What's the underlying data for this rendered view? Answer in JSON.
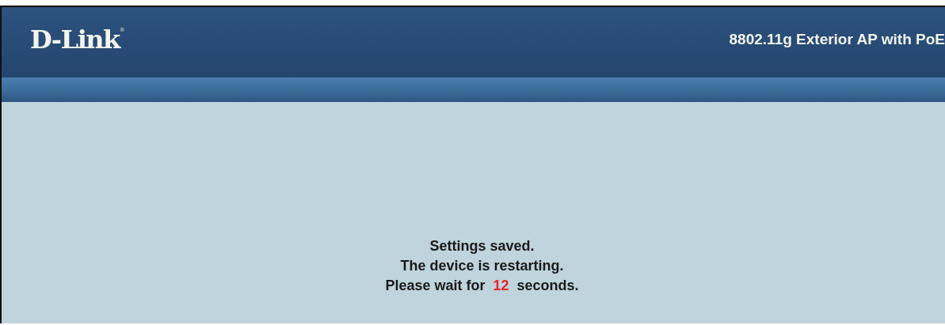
{
  "header": {
    "logo": "D-Link",
    "logo_mark": "®",
    "product_title": "8802.11g Exterior AP with PoE"
  },
  "message": {
    "lines": [
      "Settings saved.",
      "The device is restarting."
    ],
    "countdown": {
      "prefix": "Please wait for",
      "value": "12",
      "suffix": "seconds."
    }
  }
}
